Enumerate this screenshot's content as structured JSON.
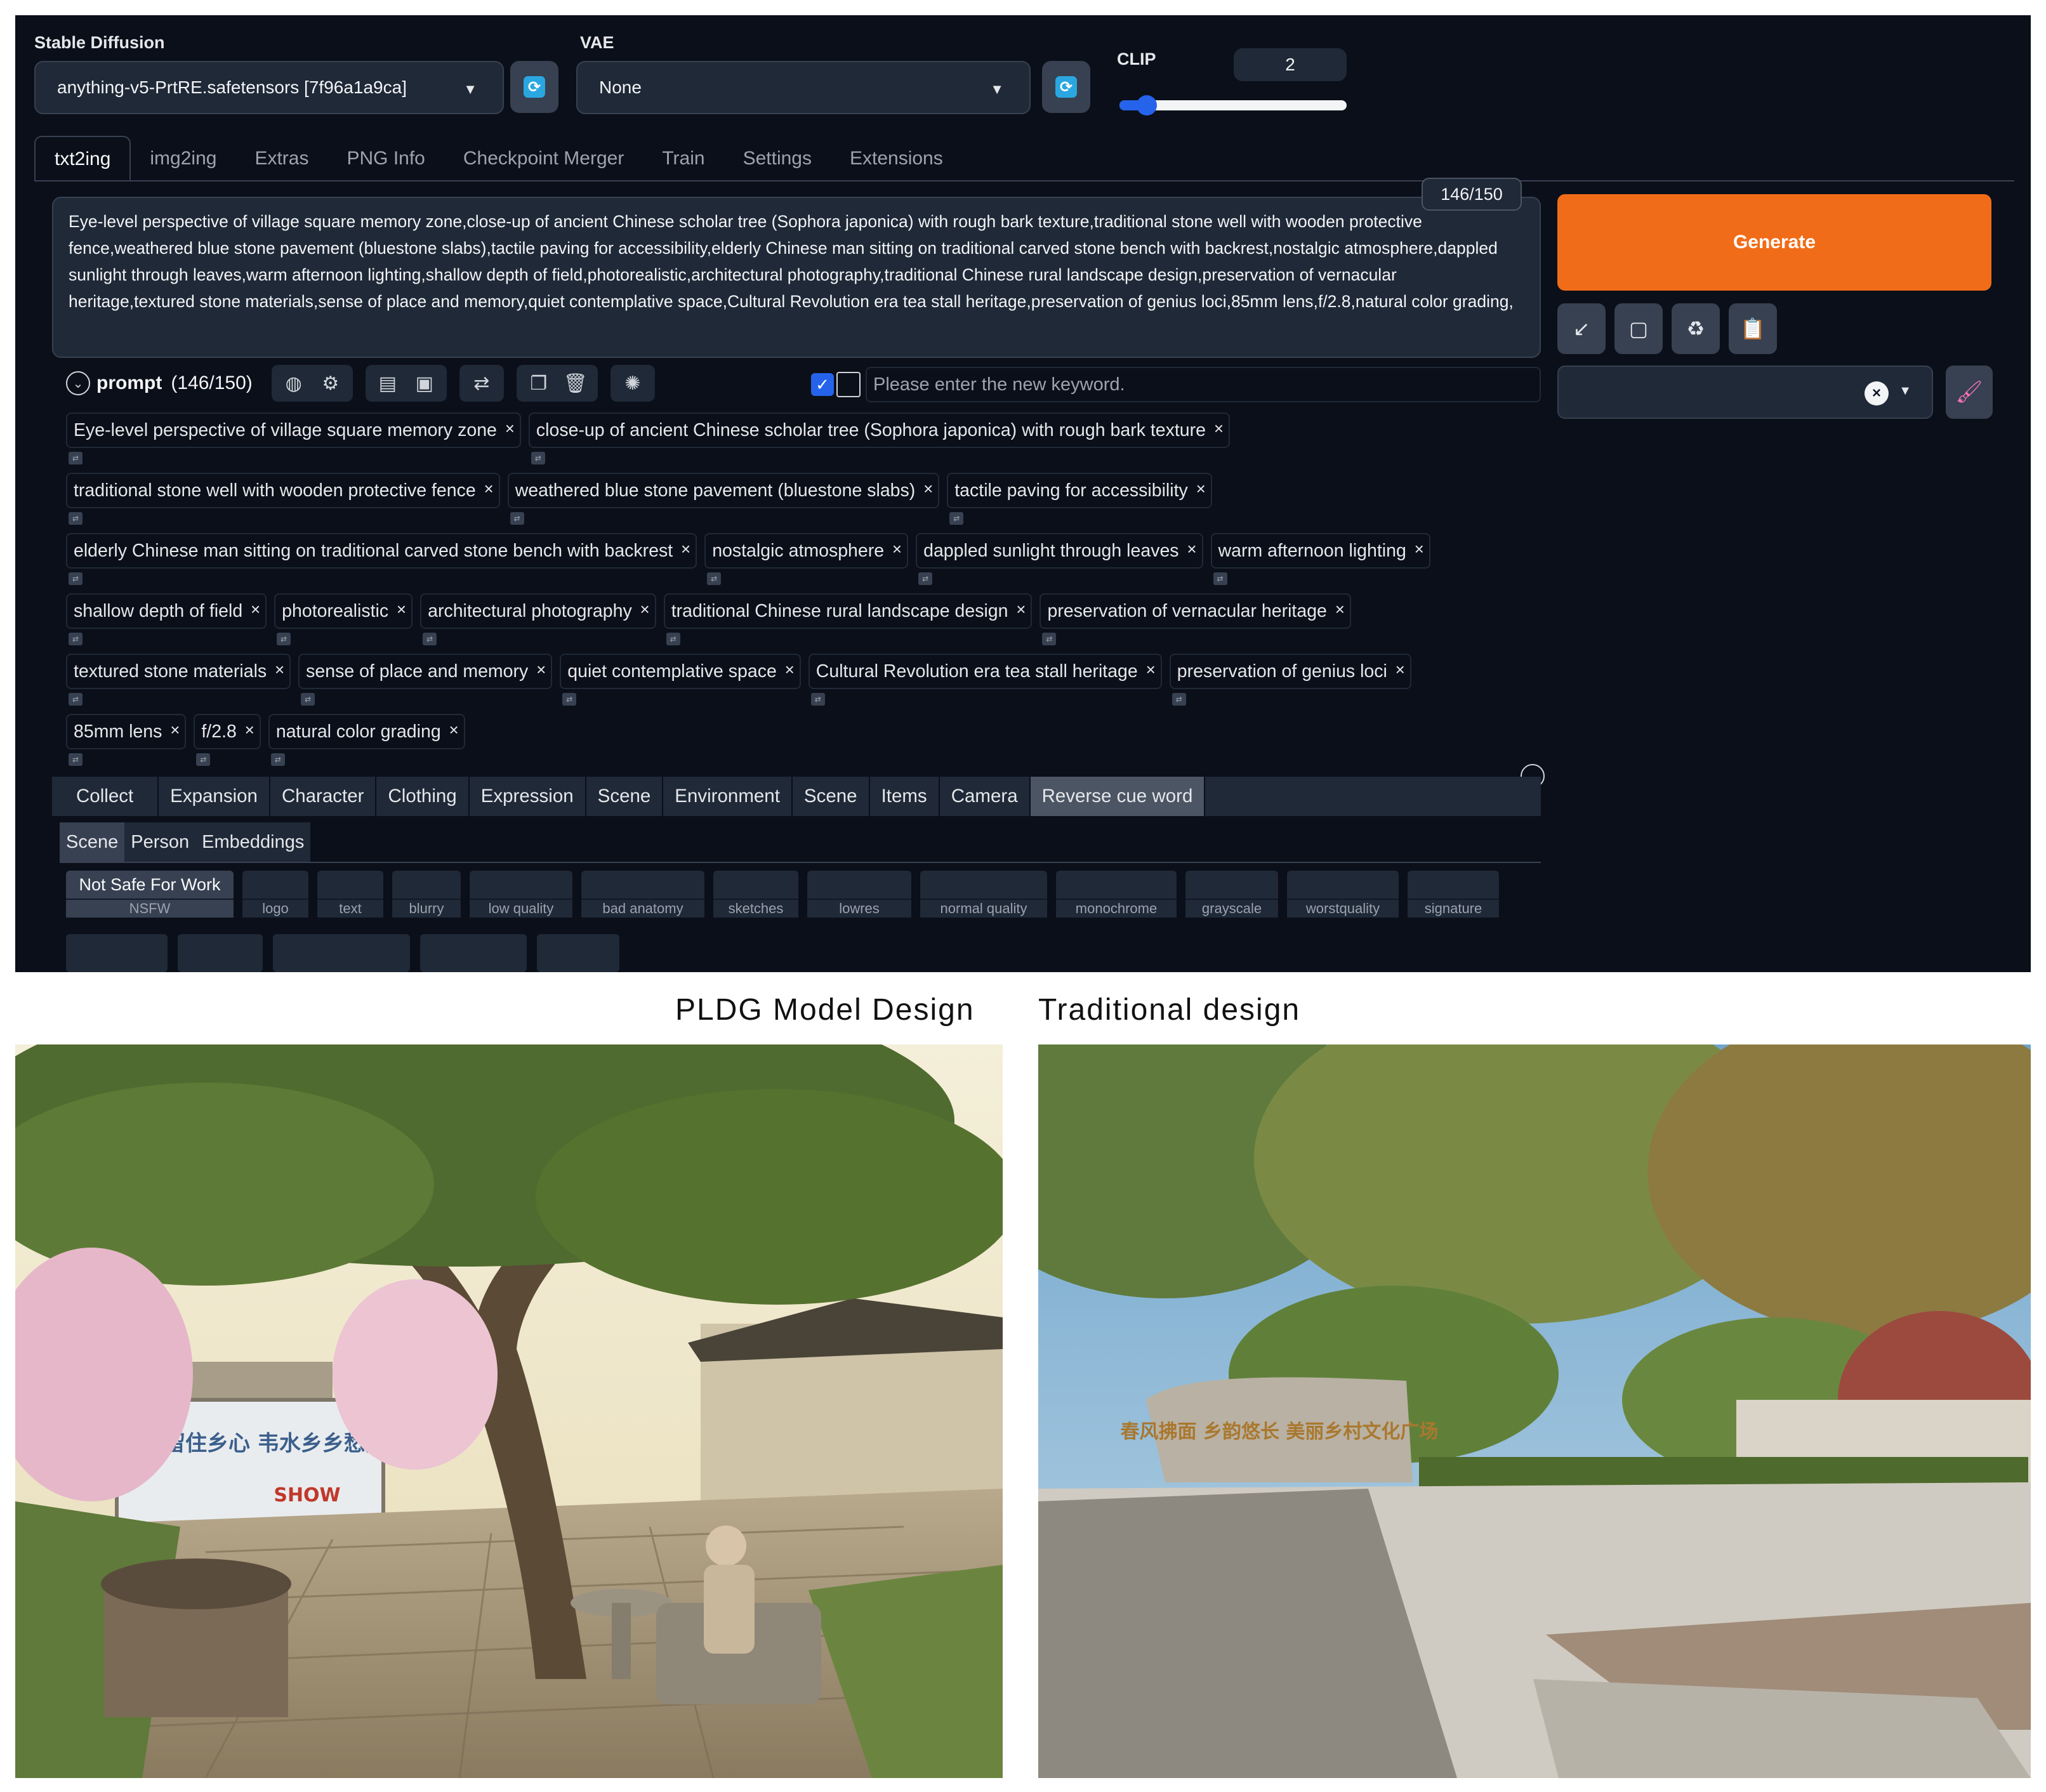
{
  "ui": {
    "checkpoint_label": "Stable Diffusion",
    "checkpoint_value": "anything-v5-PrtRE.safetensors [7f96a1a9ca]",
    "vae_label": "VAE",
    "vae_value": "None",
    "clip_label": "CLIP",
    "clip_value": "2",
    "clip_slider_fraction": 0.12,
    "tabs": [
      "txt2ing",
      "img2ing",
      "Extras",
      "PNG Info",
      "Checkpoint Merger",
      "Train",
      "Settings",
      "Extensions"
    ],
    "active_tab": "txt2ing",
    "token_counter": "146/150",
    "prompt_text": "Eye-level perspective of village square memory zone,close-up of ancient Chinese scholar tree (Sophora japonica) with rough bark texture,traditional stone well with wooden protective fence,weathered blue stone pavement (bluestone slabs),tactile paving for accessibility,elderly Chinese man sitting on traditional carved stone bench with backrest,nostalgic atmosphere,dappled sunlight through leaves,warm afternoon lighting,shallow depth of field,photorealistic,architectural photography,traditional Chinese rural landscape design,preservation of vernacular heritage,textured stone materials,sense of place and memory,quiet contemplative space,Cultural Revolution era tea stall heritage,preservation of genius loci,85mm lens,f/2.8,natural color grading,",
    "generate_label": "Generate",
    "prompt_title": "prompt",
    "prompt_count": "(146/150)",
    "keyword_placeholder": "Please enter the new keyword.",
    "tag_rows": [
      [
        "Eye-level perspective of village square memory zone",
        "close-up of ancient Chinese scholar tree (Sophora japonica) with rough bark texture"
      ],
      [
        "traditional stone well with wooden protective fence",
        "weathered blue stone pavement (bluestone slabs)",
        "tactile paving for accessibility"
      ],
      [
        "elderly Chinese man sitting on traditional carved stone bench with backrest",
        "nostalgic atmosphere",
        "dappled sunlight through leaves",
        "warm afternoon lighting"
      ],
      [
        "shallow depth of field",
        "photorealistic",
        "architectural photography",
        "traditional Chinese rural landscape design",
        "preservation of vernacular heritage"
      ],
      [
        "textured stone materials",
        "sense of place and memory",
        "quiet contemplative space",
        "Cultural Revolution era tea stall heritage",
        "preservation of genius loci"
      ],
      [
        "85mm lens",
        "f/2.8",
        "natural color grading"
      ]
    ],
    "category_tabs": [
      "Collect",
      "Expansion",
      "Character",
      "Clothing",
      "Expression",
      "Scene",
      "Environment",
      "Scene",
      "Items",
      "Camera",
      "Reverse cue word"
    ],
    "active_category": "Reverse cue word",
    "sub_tabs": [
      "Scene",
      "Person",
      "Embeddings"
    ],
    "negative_group_title": "Not Safe For Work",
    "negative_tags": [
      "NSFW",
      "logo",
      "text",
      "blurry",
      "low quality",
      "bad anatomy",
      "sketches",
      "lowres",
      "normal quality",
      "monochrome",
      "grayscale",
      "worstquality",
      "signature"
    ]
  },
  "comparison": {
    "left_caption": "PLDG Model Design",
    "right_caption": "Traditional design",
    "left_sign_text": "寻觅乡愁 留住乡心 韦水乡乡愁文化园",
    "left_sign_brand": "SHOW",
    "right_stone_text": "春风拂面 乡韵悠长 美丽乡村文化广场"
  },
  "colors": {
    "ui_background": "#0b0f19",
    "panel": "#1f2937",
    "generate": "#f16c18",
    "accent_blue": "#2563eb",
    "refresh_icon": "#2aa7e0"
  },
  "icons": [
    "refresh-icon",
    "chevron-down-icon",
    "globe-icon",
    "gear-icon",
    "note-icon",
    "bookmark-icon",
    "translate-icon",
    "copy-icon",
    "trash-icon",
    "openai-icon",
    "arrow-icon",
    "stop-icon",
    "recycle-icon",
    "clipboard-icon",
    "close-icon",
    "brush-icon"
  ]
}
